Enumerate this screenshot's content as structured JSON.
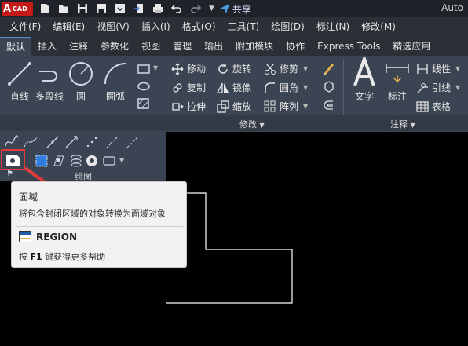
{
  "titlebar": {
    "logo_letter": "A",
    "logo_text": "CAD",
    "share_label": "共享",
    "app_title": "Auto"
  },
  "menu": [
    "文件(F)",
    "编辑(E)",
    "视图(V)",
    "插入(I)",
    "格式(O)",
    "工具(T)",
    "绘图(D)",
    "标注(N)",
    "修改(M)"
  ],
  "tabs": [
    "默认",
    "插入",
    "注释",
    "参数化",
    "视图",
    "管理",
    "输出",
    "附加模块",
    "协作",
    "Express Tools",
    "精选应用"
  ],
  "active_tab": 0,
  "draw": {
    "tools": [
      "直线",
      "多段线",
      "圆",
      "圆弧"
    ],
    "panel_title": "绘图"
  },
  "modify": {
    "tools": [
      "移动",
      "旋转",
      "修剪",
      "复制",
      "镜像",
      "圆角",
      "拉伸",
      "缩放",
      "阵列"
    ],
    "panel_title": "修改"
  },
  "annotate": {
    "big_tools": [
      "文字",
      "标注"
    ],
    "row_tools": [
      "线性",
      "引线",
      "表格"
    ],
    "panel_title": "注释"
  },
  "tooltip": {
    "title": "面域",
    "description": "将包含封闭区域的对象转换为面域对象",
    "command": "REGION",
    "help_prefix": "按",
    "help_key": "F1",
    "help_suffix": "键获得更多帮助"
  },
  "colors": {
    "accent_red": "#e23b3b",
    "ribbon_bg": "#3b4453",
    "menubar_bg": "#2b2f36",
    "canvas_bg": "#000000"
  }
}
